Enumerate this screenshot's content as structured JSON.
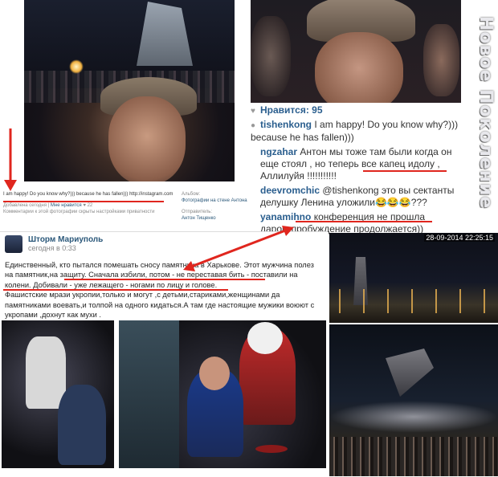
{
  "watermark": "Новое Поколение",
  "instagram": {
    "likes": "Нравится: 95",
    "comments": [
      {
        "user": "tishenkong",
        "text": " I am happy! Do you know why?))) because he has fallen)))"
      },
      {
        "user": "ngzahar",
        "text": " Антон мы тоже там были когда он еще стоял , но теперь все капец идолу , Аллилуйя !!!!!!!!!!!"
      },
      {
        "user": "deevromchic",
        "text": " @tishenkong это вы сектанты делушку Ленина уложили😂😂😂???"
      },
      {
        "user": "yanamihno",
        "text": " конференция не прошла даром,пробуждение продолжается))"
      }
    ]
  },
  "vk_photo": {
    "caption": "I am happy! Do you know why?))) because he has fallen))) http://instagram.com",
    "added": "Добавлена сегодня",
    "like_label": "Мне нравится",
    "like_count": "22",
    "settings_note": "Комментарии к этой фотографии скрыты настройками приватности",
    "album_label": "Альбом:",
    "album_value": "Фотографии на стене Антона",
    "sender_label": "Отправитель:",
    "sender_value": "Антон Тищенко"
  },
  "post": {
    "author": "Шторм Мариуполь",
    "time": "сегодня в 0:33",
    "lines": [
      "Единственный, кто пытался помешать сносу памятника в Харькове. Этот мужчина полез",
      "на памятник,на защиту. Сначала избили, потом - не переставая бить - поставили на",
      "колени. Добивали - уже лежащего - ногами по лицу и голове.",
      "Фашистские мрази укропии,только и могут ,с детьми,стариками,женщинами да",
      "памятниками воевать,и толпой на одного кидаться.А там где настоящие мужики воюют с",
      "укропами ,дохнут как мухи ."
    ]
  },
  "photo_timestamp": "28-09-2014  22:25:15",
  "colors": {
    "annotation": "#e0261e",
    "link": "#2b587a",
    "insta_user": "#2a5e8e"
  }
}
